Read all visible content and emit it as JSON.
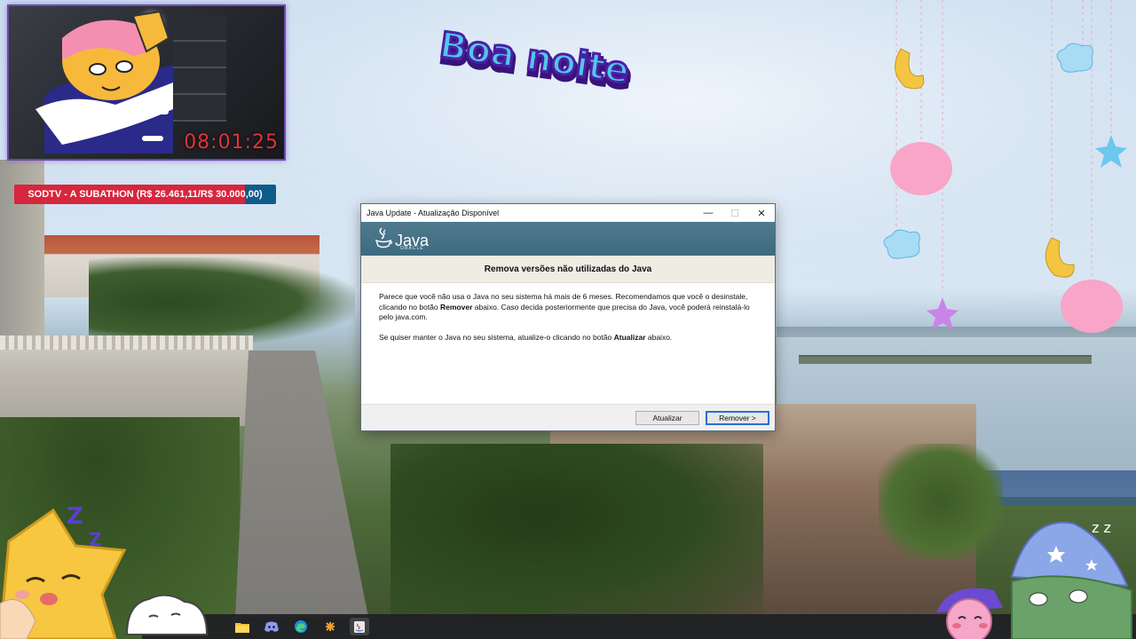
{
  "stream_overlay": {
    "timer": "08:01:25",
    "subathon_label": "SODTV - A SUBATHON (R$ 26.461,11/R$ 30.000,00)",
    "subathon_progress": 0.882,
    "banner_text": "Boa noite",
    "colors": {
      "timer": "#e0333b",
      "bar_fill": "#d7263d",
      "bar_track": "#0e5c8a",
      "cam_border": "#6d4aa8"
    }
  },
  "dialog": {
    "title": "Java Update - Atualização Disponível",
    "brand": "Java",
    "brand_sub": "ORACLE",
    "heading": "Remova versões não utilizadas do Java",
    "p1_a": "Parece que você não usa o Java no seu sistema há mais de 6 meses. Recomendamos que você o desinstale, clicando no botão ",
    "p1_bold": "Remover",
    "p1_b": " abaixo. Caso decida posteriormente que precisa do Java, você poderá reinstalá-lo pelo java.com.",
    "p2_a": "Se quiser manter o Java no seu sistema, atualize-o clicando no botão ",
    "p2_bold": "Atualizar",
    "p2_b": " abaixo.",
    "buttons": {
      "update": "Atualizar",
      "remove": "Remover >"
    },
    "window_controls": {
      "minimize": "—",
      "maximize": "☐",
      "close": "✕"
    },
    "colors": {
      "banner": "#4f7a8e",
      "heading_band": "#efece4",
      "default_button_border": "#2a6fd1"
    }
  },
  "taskbar": {
    "icons": [
      "file-explorer-icon",
      "discord-icon",
      "edge-icon",
      "plus-app-icon",
      "java-app-icon"
    ]
  }
}
